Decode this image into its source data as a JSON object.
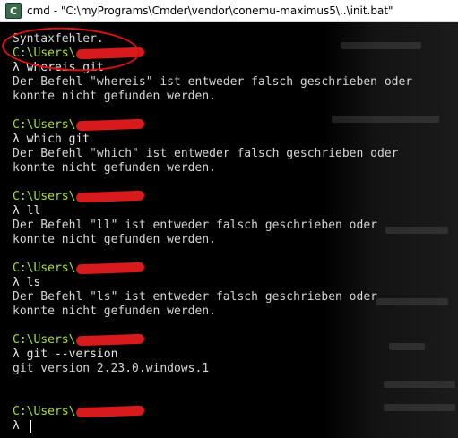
{
  "window": {
    "title": "cmd - \"C:\\myPrograms\\Cmder\\vendor\\conemu-maximus5\\..\\init.bat\"",
    "icon": "cmder-icon"
  },
  "console": {
    "first_line": "Syntaxfehler.",
    "prompt_prefix": "C:\\Users\\",
    "prompt_symbol": "λ ",
    "blocks": [
      {
        "command": "whereis git",
        "output": [
          "Der Befehl \"whereis\" ist entweder falsch geschrieben oder",
          "konnte nicht gefunden werden."
        ]
      },
      {
        "command": "which git",
        "output": [
          "Der Befehl \"which\" ist entweder falsch geschrieben oder",
          "konnte nicht gefunden werden."
        ]
      },
      {
        "command": "ll",
        "output": [
          "Der Befehl \"ll\" ist entweder falsch geschrieben oder",
          "konnte nicht gefunden werden."
        ]
      },
      {
        "command": "ls",
        "output": [
          "Der Befehl \"ls\" ist entweder falsch geschrieben oder",
          "konnte nicht gefunden werden."
        ]
      },
      {
        "command": "git --version",
        "output": [
          "git version 2.23.0.windows.1"
        ]
      }
    ]
  },
  "colors": {
    "prompt": "#a6e22e",
    "redaction": "#d71a1a",
    "annotation_circle": "#e01010"
  }
}
